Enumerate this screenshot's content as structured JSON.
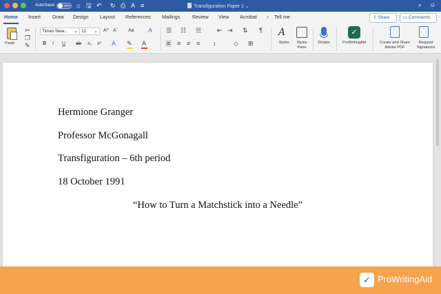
{
  "window": {
    "autosave_label": "AutoSave",
    "autosave_state": "OFF",
    "document_title": "Transfiguration Paper 1",
    "title_chevron": "⌄"
  },
  "quick_access": [
    "⌂",
    "🖫",
    "↶",
    "↻",
    "⎙",
    "A",
    "≡"
  ],
  "tabs": [
    "Home",
    "Insert",
    "Draw",
    "Design",
    "Layout",
    "References",
    "Mailings",
    "Review",
    "View",
    "Acrobat",
    "Tell me"
  ],
  "share_label": "Share",
  "comments_label": "Comments",
  "ribbon": {
    "paste_label": "Paste",
    "font_name": "Times New...",
    "font_size": "12",
    "grow_font": "A^",
    "shrink_font": "Aˇ",
    "change_case": "Aa",
    "clear_format": "A",
    "bold": "B",
    "italic": "I",
    "underline": "U",
    "strikethrough": "ab",
    "subscript": "x₂",
    "superscript": "x²",
    "text_effects": "A",
    "highlight": "✎",
    "font_color": "A",
    "styles_label": "Styles",
    "styles_pane_label": "Styles Pane",
    "dictate_label": "Dictate",
    "prowritingaid_label": "ProWritingAid",
    "create_pdf_label": "Create and Share Adobe PDF",
    "request_sig_label": "Request Signatures"
  },
  "document": {
    "lines": [
      "Hermione Granger",
      "Professor McGonagall",
      "Transfiguration – 6th period",
      "18 October 1991",
      "“How to Turn a Matchstick into a Needle”"
    ]
  },
  "banner": {
    "brand_name": "ProWritingAid"
  },
  "colors": {
    "titlebar": "#2d5ba3",
    "banner": "#f7a24c",
    "highlight": "#f3e23a",
    "font_color": "#d33a2c"
  }
}
